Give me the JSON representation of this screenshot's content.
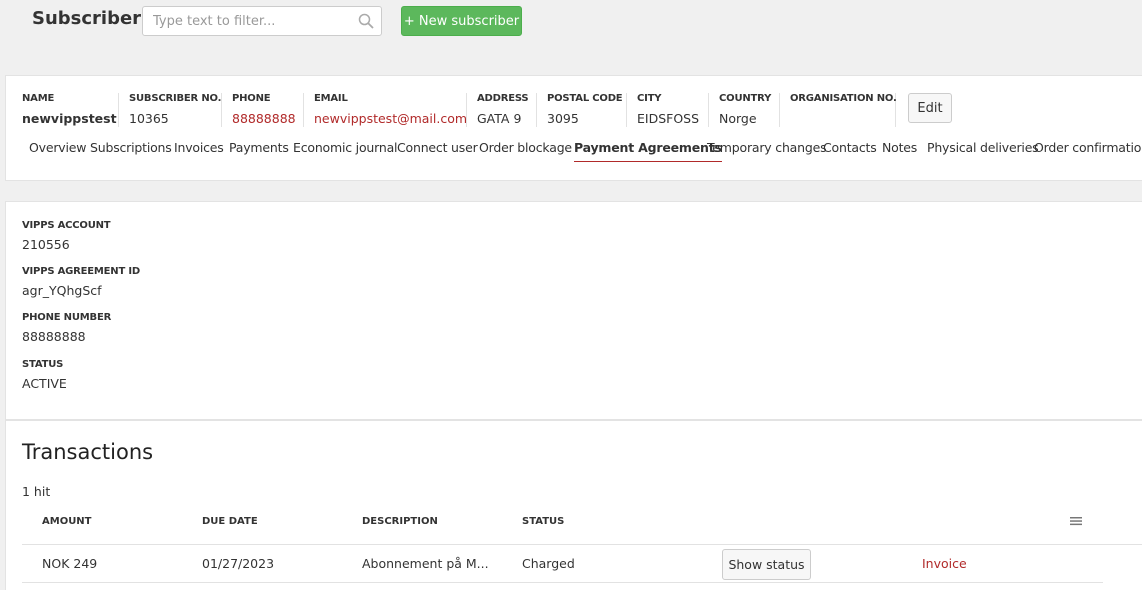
{
  "header": {
    "title": "Subscriber",
    "filter_placeholder": "Type text to filter...",
    "new_button": "+ New subscriber"
  },
  "subscriber": {
    "fields": [
      {
        "label": "NAME",
        "value": "newvippstest"
      },
      {
        "label": "SUBSCRIBER NO.",
        "value": "10365"
      },
      {
        "label": "PHONE",
        "value": "88888888"
      },
      {
        "label": "EMAIL",
        "value": "newvippstest@mail.com"
      },
      {
        "label": "ADDRESS",
        "value": "GATA 9"
      },
      {
        "label": "POSTAL CODE",
        "value": "3095"
      },
      {
        "label": "CITY",
        "value": "EIDSFOSS"
      },
      {
        "label": "COUNTRY",
        "value": "Norge"
      },
      {
        "label": "ORGANISATION NO.",
        "value": ""
      }
    ],
    "edit_button": "Edit",
    "tabs": [
      "Overview",
      "Subscriptions",
      "Invoices",
      "Payments",
      "Economic journal",
      "Connect user",
      "Order blockage",
      "Payment Agreements",
      "Temporary changes",
      "Contacts",
      "Notes",
      "Physical deliveries",
      "Order confirmation"
    ],
    "active_tab": "Payment Agreements"
  },
  "agreement": {
    "fields": [
      {
        "label": "VIPPS ACCOUNT",
        "value": "210556"
      },
      {
        "label": "VIPPS AGREEMENT ID",
        "value": "agr_YQhgScf"
      },
      {
        "label": "PHONE NUMBER",
        "value": "88888888"
      },
      {
        "label": "STATUS",
        "value": "ACTIVE"
      }
    ]
  },
  "transactions": {
    "title": "Transactions",
    "hits": "1 hit",
    "columns": [
      "AMOUNT",
      "DUE DATE",
      "DESCRIPTION",
      "STATUS"
    ],
    "rows": [
      {
        "amount": "NOK 249",
        "due_date": "01/27/2023",
        "description": "Abonnement på M...",
        "status": "Charged",
        "status_button": "Show status",
        "invoice_link": "Invoice"
      }
    ]
  },
  "colors": {
    "accent": "#b12a2a",
    "new_button": "#5cb85c"
  }
}
